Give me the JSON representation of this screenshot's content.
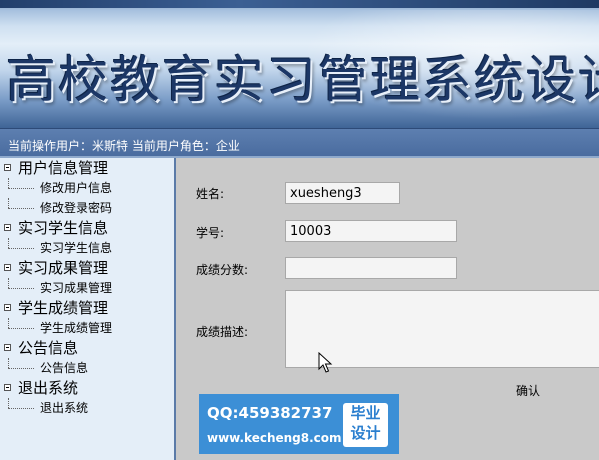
{
  "banner": {
    "title": "高校教育实习管理系统设计"
  },
  "status": {
    "text": "当前操作用户：米斯特 当前用户角色：企业"
  },
  "sidebar": {
    "groups": [
      {
        "label": "用户信息管理",
        "children": [
          "修改用户信息",
          "修改登录密码"
        ]
      },
      {
        "label": "实习学生信息",
        "children": [
          "实习学生信息"
        ]
      },
      {
        "label": "实习成果管理",
        "children": [
          "实习成果管理"
        ]
      },
      {
        "label": "学生成绩管理",
        "children": [
          "学生成绩管理"
        ]
      },
      {
        "label": "公告信息",
        "children": [
          "公告信息"
        ]
      },
      {
        "label": "退出系统",
        "children": [
          "退出系统"
        ]
      }
    ]
  },
  "form": {
    "name_label": "姓名:",
    "name_value": "xuesheng3",
    "studentno_label": "学号:",
    "studentno_value": "10003",
    "score_label": "成绩分数:",
    "score_value": "",
    "desc_label": "成绩描述:",
    "desc_value": "",
    "confirm_label": "确认"
  },
  "watermark": {
    "qq": "QQ:459382737",
    "site": "www.kecheng8.com",
    "badge_line1": "毕业",
    "badge_line2": "设计"
  },
  "colors": {
    "status_bar": "#4f72a5",
    "sidebar_bg": "#e4eef8",
    "content_bg": "#c9c9c9",
    "watermark_bg": "#3c8fd6"
  }
}
